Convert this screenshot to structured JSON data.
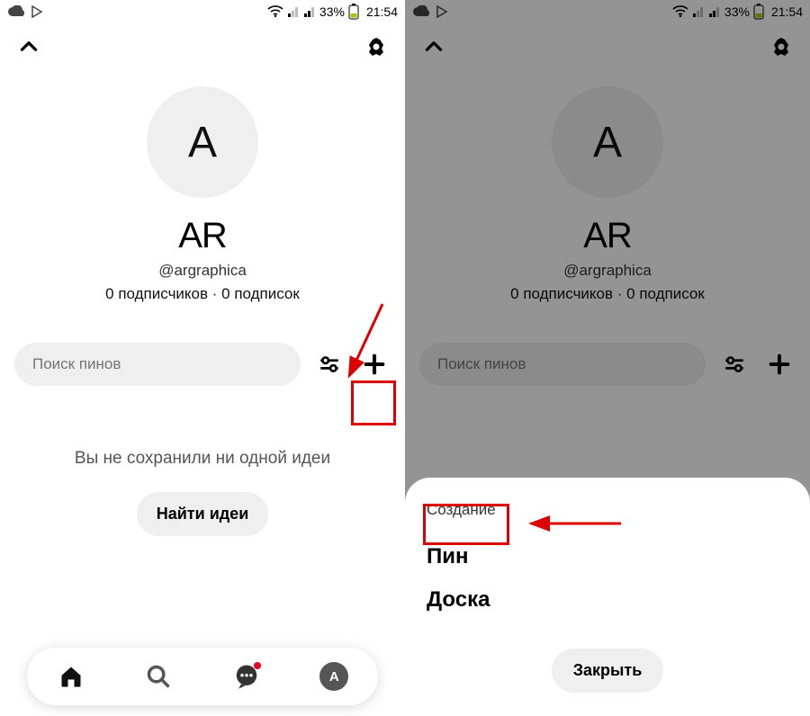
{
  "status": {
    "battery_pct": "33%",
    "time": "21:54"
  },
  "profile": {
    "avatar_letter": "A",
    "name": "AR",
    "handle": "@argraphica",
    "stats": "0 подписчиков · 0 подписок"
  },
  "search": {
    "placeholder": "Поиск пинов"
  },
  "empty": {
    "message": "Вы не сохранили ни одной идеи",
    "cta": "Найти идеи"
  },
  "nav": {
    "avatar_letter": "A"
  },
  "sheet": {
    "title": "Создание",
    "options": [
      "Пин",
      "Доска"
    ],
    "close": "Закрыть"
  }
}
